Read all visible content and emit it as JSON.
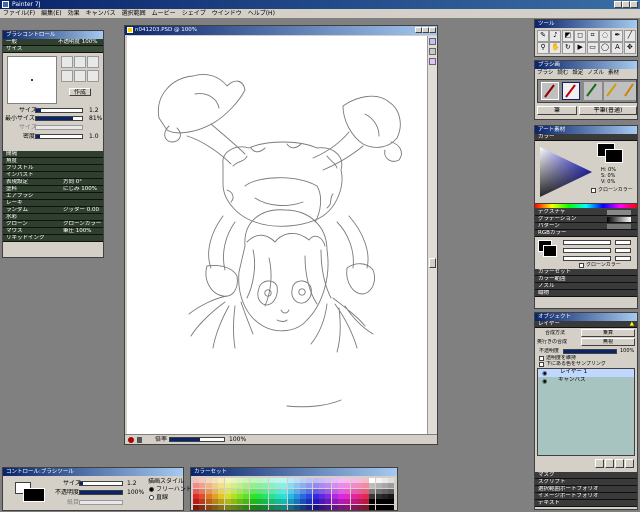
{
  "app": {
    "title": "Painter 7J"
  },
  "menu": [
    "ファイル(F)",
    "編集(E)",
    "効果",
    "キャンバス",
    "選択範囲",
    "ムービー",
    "シェイプ",
    "ウインドウ",
    "ヘルプ(H)"
  ],
  "brush_control": {
    "title": "ブラシコントロール",
    "general": "一般",
    "opacity_label": "不透明度",
    "opacity_value": "100%",
    "size_section": "サイズ",
    "preview_button": "作成",
    "size_label": "サイズ",
    "size_value": "1.2",
    "min_size_label": "最小サイズ",
    "min_size_value": "81%",
    "size_step_label": "サイズ",
    "feature_label": "密度",
    "feature_value": "1.0",
    "sections": [
      {
        "label": "間隔",
        "value": ""
      },
      {
        "label": "角度",
        "value": ""
      },
      {
        "label": "ブリストル",
        "value": ""
      },
      {
        "label": "インパスト",
        "value": ""
      },
      {
        "label": "表現設定",
        "value": "方向 0°"
      },
      {
        "label": "塗料",
        "value": "にじみ 100%"
      },
      {
        "label": "エアブラシ",
        "value": ""
      },
      {
        "label": "レーキ",
        "value": ""
      },
      {
        "label": "ランダム",
        "value": "ジッター 0.00"
      },
      {
        "label": "水彩",
        "value": ""
      },
      {
        "label": "クローン",
        "value": "クローンカラー オフ"
      },
      {
        "label": "マウス",
        "value": "筆圧 100%"
      },
      {
        "label": "リキッドインク",
        "value": ""
      }
    ]
  },
  "document": {
    "title": "n041203.PSD @ 100%",
    "zoom": "100%",
    "status_label": "倍率"
  },
  "tools_panel": {
    "title": "ツール"
  },
  "brushes_panel": {
    "title": "ブラシ画",
    "tabs": [
      "ブラシ",
      "読む",
      "設定",
      "ノズル",
      "素材"
    ],
    "category": "筆",
    "variant": "平筆(普通)"
  },
  "art_materials": {
    "title": "アート素材",
    "color_section": "カラー",
    "h_value": "H: 0%",
    "s_value": "S: 0%",
    "v_value": "V: 0%",
    "clone_color": "クローンカラー",
    "texture": "テクスチャ",
    "gradient": "グラデーション",
    "pattern": "パターン",
    "rgb_section": "RGBカラー",
    "rgb_clone_color": "クローンカラー",
    "color_set": "カラーセット",
    "color_range": "カラー範囲",
    "nozzle": "ノズル",
    "weave": "織物"
  },
  "objects": {
    "title": "オブジェクト",
    "layers_section": "レイヤー",
    "composite_method_label": "合成方法",
    "composite_method_value": "乗算",
    "composite_depth_label": "奥行きの合成",
    "composite_depth_value": "無視",
    "opacity_label": "不透明度",
    "opacity_value": "100%",
    "preserve_transparency": "透明度を維持",
    "pick_up_underlying": "下にある色をサンプリング",
    "layers": [
      {
        "name": "レイヤー 1",
        "selected": true
      },
      {
        "name": "キャンバス",
        "selected": false
      }
    ],
    "bottom_sections": [
      "マスク",
      "スクリプト",
      "選択範囲ポートフォリオ",
      "イメージポートフォリオ",
      "テキスト"
    ]
  },
  "control_brush": {
    "title": "コントロール:ブラシツール",
    "style_label": "描画スタイル",
    "freehand": "フリーハンド",
    "straight": "直線",
    "size_label": "サイズ",
    "size_value": "1.2",
    "opacity_label": "不透明度",
    "opacity_value": "100%",
    "grain_label": "紙目"
  },
  "color_set_panel": {
    "title": "カラーセット"
  }
}
